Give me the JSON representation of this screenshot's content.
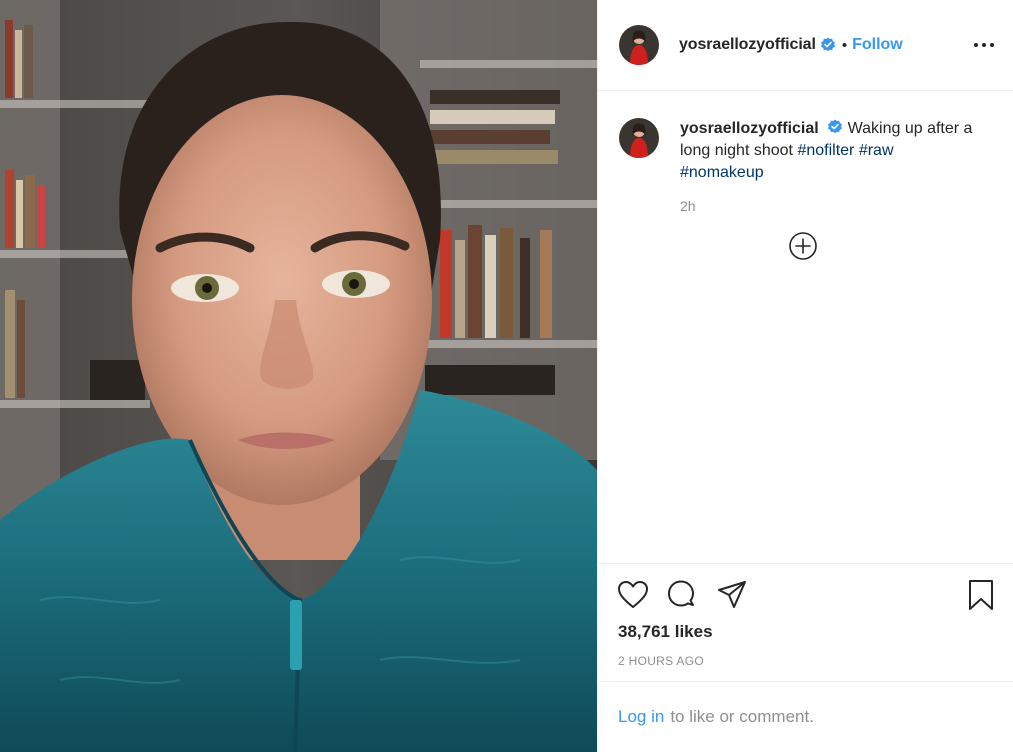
{
  "post": {
    "username": "yosraellozyofficial",
    "verified": true,
    "separator": "•",
    "follow_label": "Follow",
    "more_icon": "more-options-icon"
  },
  "caption": {
    "username": "yosraellozyofficial",
    "text": "Waking up after a long night shoot",
    "hashtags": [
      "#nofilter",
      "#raw",
      "#nomakeup"
    ],
    "time": "2h"
  },
  "actions": {
    "like_icon": "heart-icon",
    "comment_icon": "comment-icon",
    "share_icon": "paper-plane-icon",
    "save_icon": "bookmark-icon",
    "likes": "38,761 likes",
    "posted_ago": "2 HOURS AGO"
  },
  "footer": {
    "login_label": "Log in",
    "login_suffix": "to like or comment."
  },
  "colors": {
    "link_blue": "#3897f0",
    "hashtag": "#003569",
    "muted": "#8e8e8e",
    "verified_badge": "#3897f0"
  }
}
